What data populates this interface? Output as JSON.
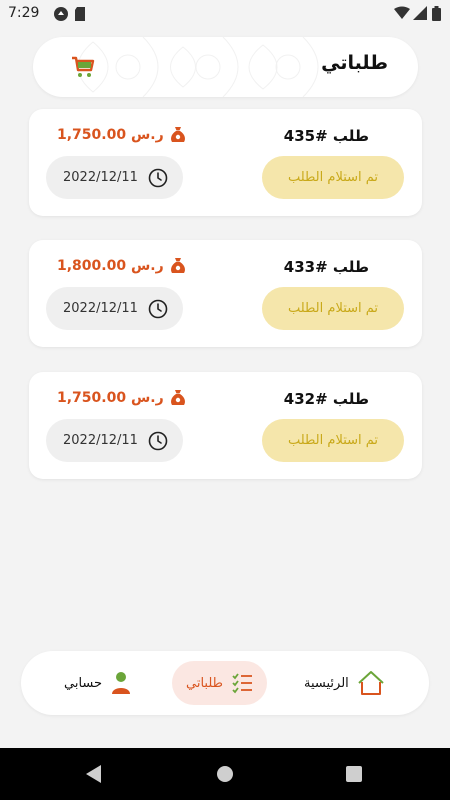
{
  "status_bar": {
    "time": "7:29"
  },
  "header": {
    "title": "طلباتي",
    "cart_icon": "cart-icon"
  },
  "orders": [
    {
      "title": "طلب #435",
      "price": "1,750.00 ر.س",
      "status": "تم استلام الطلب",
      "date": "2022/12/11"
    },
    {
      "title": "طلب #433",
      "price": "1,800.00 ر.س",
      "status": "تم استلام الطلب",
      "date": "2022/12/11"
    },
    {
      "title": "طلب #432",
      "price": "1,750.00 ر.س",
      "status": "تم استلام الطلب",
      "date": "2022/12/11"
    }
  ],
  "bottom_nav": {
    "home_label": "الرئيسية",
    "orders_label": "طلباتي",
    "account_label": "حسابي",
    "active": "orders"
  },
  "colors": {
    "accent": "#d9541e",
    "status_bg": "#f5e6ab",
    "status_text": "#c9a91a",
    "green": "#6ba539"
  }
}
